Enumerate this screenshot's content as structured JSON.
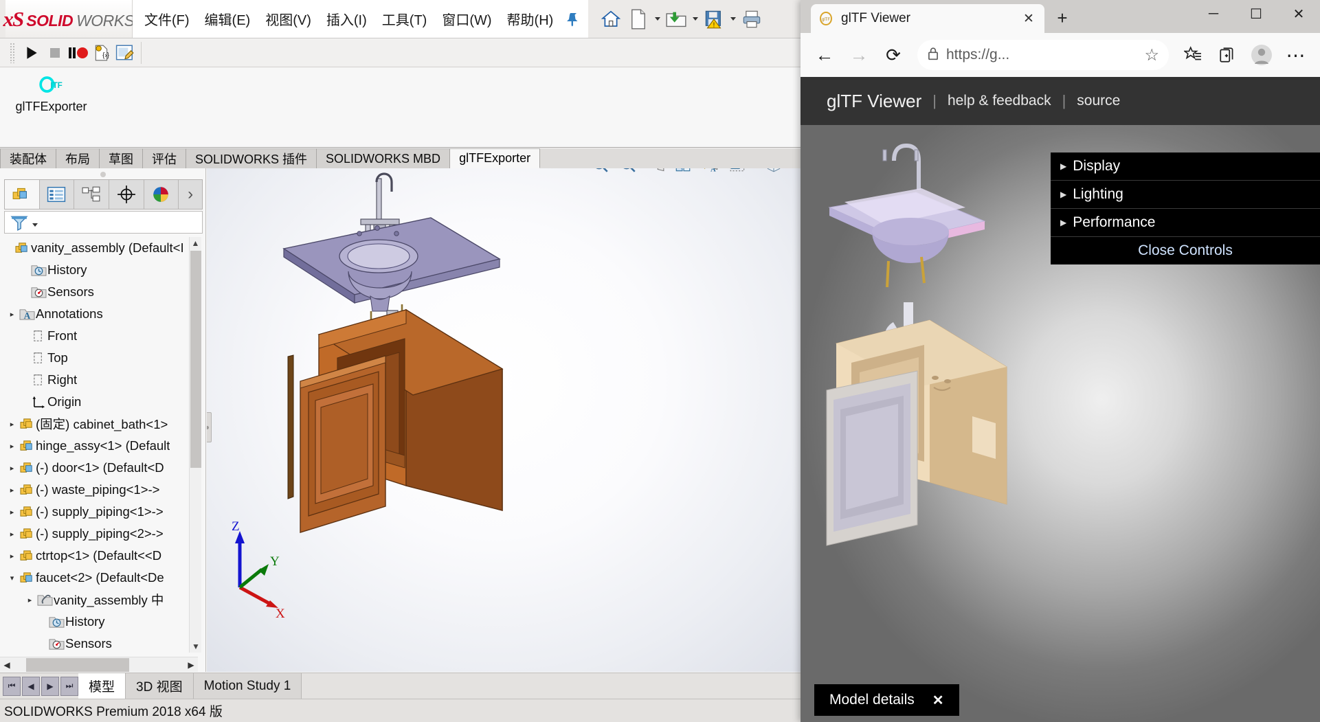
{
  "solidworks": {
    "logo": {
      "ds": "ʙS",
      "solid": "SOLID",
      "works": "WORKS"
    },
    "menus": [
      {
        "label": "文件(F)"
      },
      {
        "label": "编辑(E)"
      },
      {
        "label": "视图(V)"
      },
      {
        "label": "插入(I)"
      },
      {
        "label": "工具(T)"
      },
      {
        "label": "窗口(W)"
      },
      {
        "label": "帮助(H)"
      }
    ],
    "pin_icon": "pushpin-icon",
    "quick_access": [
      {
        "name": "home-icon"
      },
      {
        "name": "new-document-icon",
        "caret": true
      },
      {
        "name": "open-folder-icon",
        "caret": true
      },
      {
        "name": "save-warning-icon",
        "caret": true
      },
      {
        "name": "print-icon",
        "caret": true
      },
      {
        "name": "undo-icon",
        "caret": true
      },
      {
        "name": "select-arrow-icon",
        "caret": true
      },
      {
        "name": "rebuild-traffic-light-icon"
      }
    ],
    "motion_toolbar": [
      {
        "name": "play-icon"
      },
      {
        "name": "stop-icon"
      },
      {
        "name": "pause-record-icon"
      },
      {
        "name": "animation-wizard-icon"
      },
      {
        "name": "motion-study-properties-icon"
      }
    ],
    "command_area": {
      "button_label": "glTFExporter",
      "button_icon": "gltf-logo-icon"
    },
    "tabs": [
      {
        "label": "装配体",
        "active": false
      },
      {
        "label": "布局",
        "active": false
      },
      {
        "label": "草图",
        "active": false
      },
      {
        "label": "评估",
        "active": false
      },
      {
        "label": "SOLIDWORKS 插件",
        "active": false
      },
      {
        "label": "SOLIDWORKS MBD",
        "active": false
      },
      {
        "label": "glTFExporter",
        "active": true
      }
    ],
    "tree_panel": {
      "tabs": [
        {
          "name": "feature-manager-tab",
          "active": true
        },
        {
          "name": "property-manager-tab",
          "active": false
        },
        {
          "name": "configuration-manager-tab",
          "active": false
        },
        {
          "name": "dimxpert-manager-tab",
          "active": false
        },
        {
          "name": "display-manager-tab",
          "active": false
        }
      ],
      "more_icon": "›",
      "filter_icon": "filter-icon",
      "items": [
        {
          "label": "vanity_assembly  (Default<I",
          "indent": 0,
          "arrow": "",
          "icon": "assembly-icon"
        },
        {
          "label": "History",
          "indent": 1,
          "arrow": "",
          "icon": "history-folder-icon"
        },
        {
          "label": "Sensors",
          "indent": 1,
          "arrow": "",
          "icon": "sensors-folder-icon"
        },
        {
          "label": "Annotations",
          "indent": 1,
          "arrow": "▸",
          "icon": "annotations-folder-icon"
        },
        {
          "label": "Front",
          "indent": 1,
          "arrow": "",
          "icon": "plane-icon"
        },
        {
          "label": "Top",
          "indent": 1,
          "arrow": "",
          "icon": "plane-icon"
        },
        {
          "label": "Right",
          "indent": 1,
          "arrow": "",
          "icon": "plane-icon"
        },
        {
          "label": "Origin",
          "indent": 1,
          "arrow": "",
          "icon": "origin-icon"
        },
        {
          "label": "(固定) cabinet_bath<1>",
          "indent": 0,
          "arrow": "▸",
          "icon": "part-yellow-icon"
        },
        {
          "label": "hinge_assy<1> (Default",
          "indent": 0,
          "arrow": "▸",
          "icon": "subassembly-icon"
        },
        {
          "label": "(-) door<1> (Default<D",
          "indent": 0,
          "arrow": "▸",
          "icon": "subassembly-icon"
        },
        {
          "label": "(-) waste_piping<1>->",
          "indent": 0,
          "arrow": "▸",
          "icon": "part-yellow-icon"
        },
        {
          "label": "(-) supply_piping<1>->",
          "indent": 0,
          "arrow": "▸",
          "icon": "part-yellow-icon"
        },
        {
          "label": "(-) supply_piping<2>->",
          "indent": 0,
          "arrow": "▸",
          "icon": "part-yellow-icon"
        },
        {
          "label": "ctrtop<1> (Default<<D",
          "indent": 0,
          "arrow": "▸",
          "icon": "part-yellow-icon"
        },
        {
          "label": "faucet<2> (Default<De",
          "indent": 0,
          "arrow": "▾",
          "icon": "subassembly-icon"
        },
        {
          "label": "vanity_assembly 中",
          "indent": 2,
          "arrow": "▸",
          "icon": "mates-folder-icon"
        },
        {
          "label": "History",
          "indent": 2,
          "arrow": "",
          "icon": "history-folder-icon"
        },
        {
          "label": "Sensors",
          "indent": 2,
          "arrow": "",
          "icon": "sensors-folder-icon"
        }
      ]
    },
    "view_toolbar": [
      {
        "name": "zoom-to-fit-icon"
      },
      {
        "name": "zoom-to-area-icon"
      },
      {
        "name": "previous-view-icon"
      },
      {
        "name": "section-view-icon"
      },
      {
        "name": "view-orientation-flash-icon"
      },
      {
        "name": "display-style-icon",
        "caret": true
      },
      {
        "name": "hide-show-items-icon",
        "caret": true
      },
      {
        "name": "appearances-icon",
        "caret": true
      }
    ],
    "triad": {
      "x": "X",
      "y": "Y",
      "z": "Z"
    },
    "bottom_tabs": [
      {
        "label": "模型",
        "active": true
      },
      {
        "label": "3D 视图",
        "active": false
      },
      {
        "label": "Motion Study 1",
        "active": false
      }
    ],
    "nav_buttons": [
      "⏮",
      "◀",
      "▶",
      "⏭"
    ],
    "status_text": "SOLIDWORKS Premium 2018 x64 版"
  },
  "browser": {
    "tab": {
      "title": "glTF Viewer",
      "favicon": "gltf-favicon-icon",
      "close": "✕"
    },
    "new_tab": "+",
    "window_buttons": {
      "minimize": "─",
      "maximize": "☐",
      "close": "✕"
    },
    "toolbar": {
      "back": "←",
      "forward": "→",
      "refresh": "⟳",
      "lock_icon": "lock-icon",
      "url": "https://g...",
      "star": "☆",
      "favorites": "favorites-icon",
      "collections": "collections-icon",
      "profile": "profile-avatar-icon",
      "more": "⋯"
    }
  },
  "gltf_viewer": {
    "brand": "glTF Viewer",
    "links": [
      {
        "label": "help & feedback"
      },
      {
        "label": "source"
      }
    ],
    "controls": [
      {
        "label": "Display"
      },
      {
        "label": "Lighting"
      },
      {
        "label": "Performance"
      }
    ],
    "close_controls": "Close Controls",
    "model_details": {
      "label": "Model details",
      "close": "✕"
    }
  },
  "colors": {
    "sw_red": "#cf0a2c",
    "gltf_cyan": "#00e5e5",
    "viewer_dark": "#333333",
    "controls_black": "#000000",
    "link_blue": "#cfe3ff"
  }
}
